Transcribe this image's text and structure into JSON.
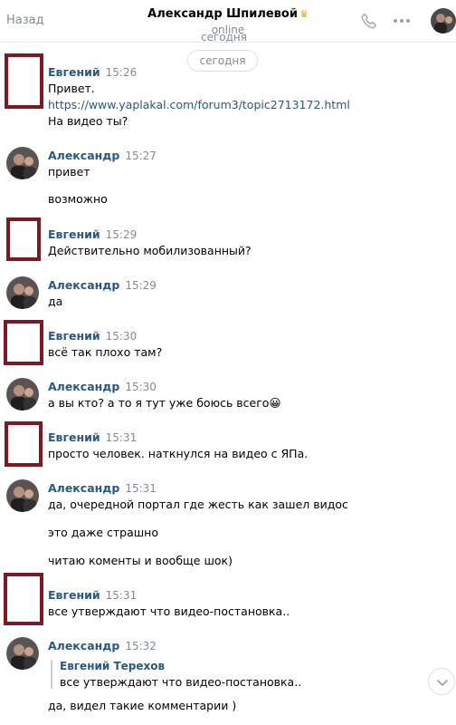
{
  "header": {
    "back_label": "Назад",
    "title": "Александр Шпилевой",
    "status": "online"
  },
  "date_separator": "сегодня",
  "messages": [
    {
      "author": "Евгений",
      "time": "15:26",
      "lines": [
        "Привет.",
        "https://www.yaplakal.com/forum3/topic2713172.html",
        "На видео ты?"
      ]
    },
    {
      "author": "Александр",
      "time": "15:27",
      "lines": [
        "привет",
        "возможно"
      ]
    },
    {
      "author": "Евгений",
      "time": "15:29",
      "lines": [
        "Действительно мобилизованный?"
      ]
    },
    {
      "author": "Александр",
      "time": "15:29",
      "lines": [
        "да"
      ]
    },
    {
      "author": "Евгений",
      "time": "15:30",
      "lines": [
        "всё так плохо там?"
      ]
    },
    {
      "author": "Александр",
      "time": "15:30",
      "lines": [
        "а вы кто? а то я тут уже боюсь всего😀"
      ]
    },
    {
      "author": "Евгений",
      "time": "15:31",
      "lines": [
        "просто человек. наткнулся на видео с ЯПа."
      ]
    },
    {
      "author": "Александр",
      "time": "15:31",
      "lines": [
        "да, очередной портал где жесть как зашел видос",
        "это даже страшно",
        "читаю коменты и вообще шок)"
      ]
    },
    {
      "author": "Евгений",
      "time": "15:31",
      "lines": [
        "все утверждают что видео-постановка.."
      ]
    },
    {
      "author": "Александр",
      "time": "15:32",
      "lines": [
        "да, видел такие комментарии )"
      ],
      "quote": {
        "author": "Евгений Терехов",
        "text": "все утверждают что видео-постановка.."
      }
    }
  ],
  "icons": {
    "call": "phone-icon",
    "more": "more-icon",
    "scroll": "chevron-down-icon"
  },
  "colors": {
    "accent": "#2a5885",
    "muted": "#818c99",
    "avatar_frame": "#7a1a25"
  }
}
